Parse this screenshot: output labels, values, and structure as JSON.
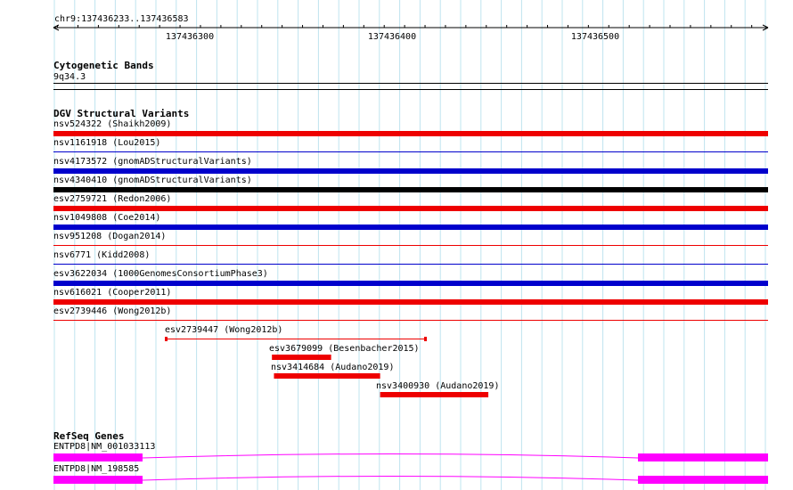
{
  "ruler": {
    "location": "chr9:137436233..137436583",
    "ticks": [
      "137436300",
      "137436400",
      "137436500"
    ]
  },
  "tracks": {
    "cyto": {
      "title": "Cytogenetic Bands",
      "band": "9q34.3"
    },
    "dgv": {
      "title": "DGV Structural Variants",
      "full_rows": [
        {
          "label": "nsv524322 (Shaikh2009)",
          "color": "#ee0000",
          "style": "thick"
        },
        {
          "label": "nsv1161918 (Lou2015)",
          "color": "#0000cc",
          "style": "thin"
        },
        {
          "label": "nsv4173572 (gnomADStructuralVariants)",
          "color": "#0000cc",
          "style": "thick"
        },
        {
          "label": "nsv4340410 (gnomADStructuralVariants)",
          "color": "#000000",
          "style": "thick"
        },
        {
          "label": "esv2759721 (Redon2006)",
          "color": "#ee0000",
          "style": "thick"
        },
        {
          "label": "nsv1049808 (Coe2014)",
          "color": "#0000cc",
          "style": "thick"
        },
        {
          "label": "nsv951208 (Dogan2014)",
          "color": "#ee0000",
          "style": "thin"
        },
        {
          "label": "nsv6771 (Kidd2008)",
          "color": "#0000cc",
          "style": "thin"
        },
        {
          "label": "esv3622034 (1000GenomesConsortiumPhase3)",
          "color": "#0000cc",
          "style": "thick"
        },
        {
          "label": "nsv616021 (Cooper2011)",
          "color": "#ee0000",
          "style": "thick"
        },
        {
          "label": "esv2739446 (Wong2012b)",
          "color": "#ee0000",
          "style": "thin"
        }
      ],
      "partial_rows": [
        {
          "label": "esv2739447 (Wong2012b)",
          "start": 137436288,
          "end": 137436415,
          "color": "#ee0000",
          "style": "thin"
        },
        {
          "label": "esv3679099 (Besenbacher2015)",
          "start": 137436340,
          "end": 137436369,
          "color": "#ee0000",
          "style": "thick"
        },
        {
          "label": "nsv3414684 (Audano2019)",
          "start": 137436341,
          "end": 137436393,
          "color": "#ee0000",
          "style": "thick"
        },
        {
          "label": "nsv3400930 (Audano2019)",
          "start": 137436393,
          "end": 137436446,
          "color": "#ee0000",
          "style": "thick"
        }
      ]
    },
    "refseq": {
      "title": "RefSeq Genes",
      "genes": [
        {
          "label": "ENTPD8|NM_001033113",
          "color": "#ff00ff"
        },
        {
          "label": "ENTPD8|NM_198585",
          "color": "#ff00ff"
        }
      ]
    }
  }
}
